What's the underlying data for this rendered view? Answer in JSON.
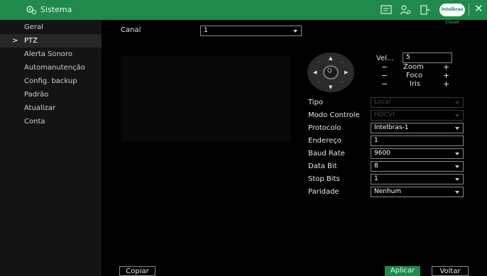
{
  "titlebar": {
    "title": "Sistema",
    "cloud_label": "Intelbras Cloud"
  },
  "sidebar": {
    "items": [
      {
        "label": "Geral"
      },
      {
        "label": "PTZ"
      },
      {
        "label": "Alerta Sonoro"
      },
      {
        "label": "Automanutenção"
      },
      {
        "label": "Config. backup"
      },
      {
        "label": "Padrão"
      },
      {
        "label": "Atualizar"
      },
      {
        "label": "Conta"
      }
    ],
    "active_index": 1,
    "active_marker": ">"
  },
  "form": {
    "canal_label": "Canal",
    "canal_value": "1",
    "vel_label": "Vel...",
    "vel_value": "5",
    "zoom_label": "Zoom",
    "foco_label": "Foco",
    "iris_label": "Iris",
    "minus": "−",
    "plus": "+",
    "tipo_label": "Tipo",
    "tipo_value": "Local",
    "modo_label": "Modo Controle",
    "modo_value": "HDCVI",
    "protocolo_label": "Protocolo",
    "protocolo_value": "Intelbras-1",
    "endereco_label": "Endereço",
    "endereco_value": "1",
    "baud_label": "Baud Rate",
    "baud_value": "9600",
    "databit_label": "Data Bit",
    "databit_value": "8",
    "stopbits_label": "Stop Bits",
    "stopbits_value": "1",
    "paridade_label": "Paridade",
    "paridade_value": "Nenhum"
  },
  "buttons": {
    "copy": "Copiar",
    "apply": "Aplicar",
    "back": "Voltar"
  },
  "colors": {
    "accent": "#1f8a4c",
    "background": "#000000",
    "sidebar": "#141414"
  }
}
